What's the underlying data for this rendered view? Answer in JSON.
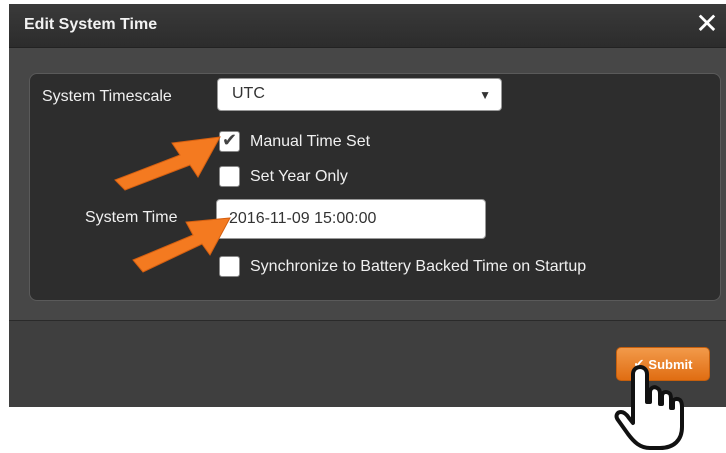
{
  "dialog": {
    "title": "Edit System Time",
    "close_glyph": "✕"
  },
  "form": {
    "timescale_label": "System Timescale",
    "timescale_value": "UTC",
    "manual_time_label": "Manual Time Set",
    "manual_time_checked": true,
    "year_only_label": "Set Year Only",
    "year_only_checked": false,
    "system_time_label": "System Time",
    "system_time_value": "2016-11-09 15:00:00",
    "sync_label": "Synchronize to Battery Backed Time on Startup",
    "sync_checked": false
  },
  "footer": {
    "submit_label": "Submit"
  },
  "annotations": {
    "arrow_color": "#f47a20",
    "icons": [
      "arrow-icon",
      "hand-pointer-icon"
    ]
  }
}
